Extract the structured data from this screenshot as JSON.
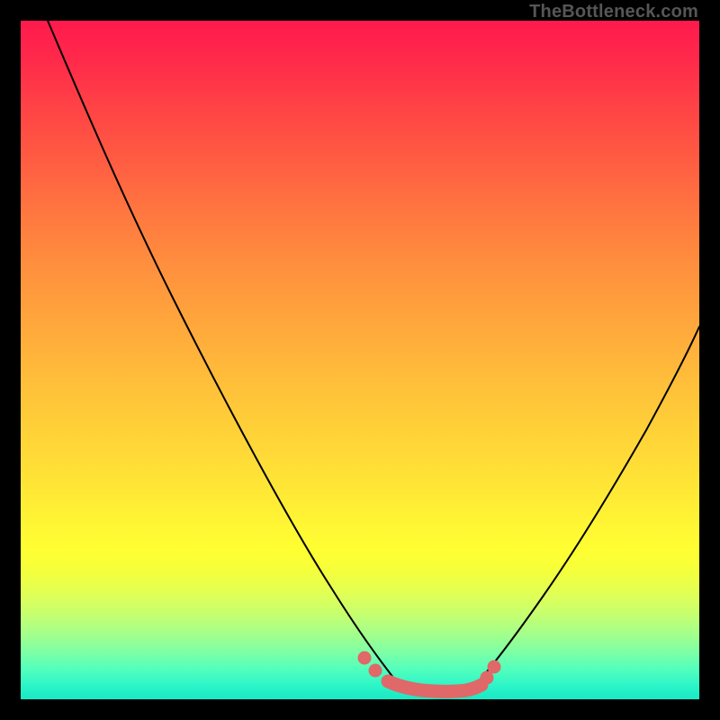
{
  "watermark": "TheBottleneck.com",
  "chart_data": {
    "type": "line",
    "title": "",
    "xlabel": "",
    "ylabel": "",
    "xlim": [
      0,
      100
    ],
    "ylim": [
      0,
      100
    ],
    "series": [
      {
        "name": "left-curve",
        "x": [
          4,
          10,
          20,
          30,
          40,
          47,
          50,
          52,
          54
        ],
        "y": [
          100,
          86,
          63,
          41,
          21,
          9,
          5,
          3,
          2
        ]
      },
      {
        "name": "right-curve",
        "x": [
          67,
          70,
          75,
          80,
          85,
          90,
          95,
          100
        ],
        "y": [
          2,
          4,
          9,
          17,
          27,
          38,
          49,
          59
        ]
      },
      {
        "name": "highlight-flat",
        "x": [
          54,
          56,
          58,
          60,
          62,
          64,
          66,
          67
        ],
        "y": [
          2,
          1.5,
          1.3,
          1.2,
          1.2,
          1.4,
          1.7,
          2
        ]
      }
    ],
    "highlight": {
      "color": "#e06868",
      "range_x": [
        50,
        69
      ],
      "dots_x": [
        50.5,
        52,
        54,
        67,
        68.5
      ],
      "description": "optimal-zone marker along valley bottom"
    },
    "background": {
      "type": "vertical-gradient",
      "stops": [
        {
          "pos": 0,
          "color": "#ff1a4d"
        },
        {
          "pos": 50,
          "color": "#ffb03a"
        },
        {
          "pos": 78,
          "color": "#ffff32"
        },
        {
          "pos": 100,
          "color": "#18e8c4"
        }
      ]
    }
  }
}
